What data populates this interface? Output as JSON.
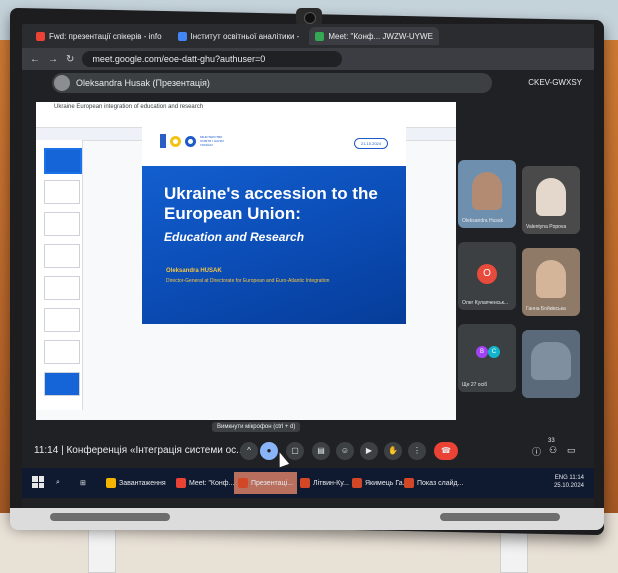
{
  "browser": {
    "tabs": [
      {
        "label": "Fwd: презентації спікерів - info",
        "color": "#ea4335"
      },
      {
        "label": "Інститут освітньої аналітики -",
        "color": "#4285f4"
      },
      {
        "label": "Meet: \"Конф... JWZW-UYWE",
        "color": "#34a853"
      }
    ],
    "url": "meet.google.com/eoe-datt-ghu?authuser=0"
  },
  "meet": {
    "presenter_label": "Oleksandra Husak (Презентація)",
    "room_code": "CKEV-GWXSY"
  },
  "slides_editor": {
    "doc_title": "Ukraine European integration of education and research"
  },
  "slide": {
    "date": "21.10.2024",
    "title": "Ukraine's accession to the European Union:",
    "subtitle": "Education and Research",
    "author": "Oleksandra HUSAK",
    "role": "Director-General at Directorate for European and Euro-Atlantic Integration"
  },
  "participants": [
    {
      "name": "Oleksandra Husak",
      "kind": "video"
    },
    {
      "name": "Valentyna Popova",
      "kind": "video"
    },
    {
      "name": "Олег Кулапченськ...",
      "kind": "initial",
      "initial": "О",
      "color": "#e84b3c"
    },
    {
      "name": "Ганна Бойківська",
      "kind": "video"
    },
    {
      "name": "Ще 27 осіб",
      "kind": "more"
    },
    {
      "name": "",
      "kind": "video"
    }
  ],
  "controls": {
    "time": "11:14",
    "meeting_name": "Конференція «Інтеграція системи ос...",
    "mic_tooltip": "Вимкнути мікрофон (ctrl + d)",
    "participant_count": "33"
  },
  "taskbar": {
    "items": [
      {
        "label": "Завантаження",
        "color": "#f5b400"
      },
      {
        "label": "Meet: \"Конф...",
        "color": "#ea4335"
      },
      {
        "label": "Презентаці...",
        "color": "#d24726"
      },
      {
        "label": "Літвин-Ку...",
        "color": "#d24726"
      },
      {
        "label": "Якимець Га...",
        "color": "#d24726"
      },
      {
        "label": "Показ слайд...",
        "color": "#d24726"
      }
    ],
    "clock_time": "11:14",
    "clock_date": "25.10.2024",
    "lang": "ENG"
  }
}
